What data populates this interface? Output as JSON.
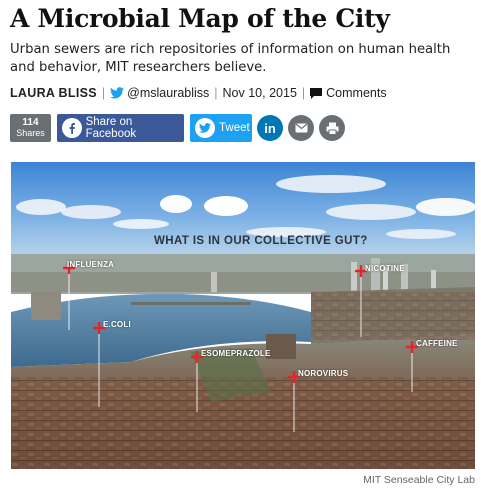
{
  "article": {
    "headline": "A Microbial Map of the City",
    "dek": "Urban sewers are rich repositories of information on human health and behavior, MIT researchers believe.",
    "author": "LAURA BLISS",
    "twitter": "@mslaurabliss",
    "date": "Nov 10, 2015",
    "comments_label": "Comments"
  },
  "share": {
    "count": "114",
    "count_label": "Shares",
    "facebook_label": "Share on Facebook",
    "tweet_label": "Tweet",
    "linkedin_label": "in"
  },
  "figure": {
    "question": "WHAT IS IN OUR COLLECTIVE GUT?",
    "labels": {
      "influenza": "INFLUENZA",
      "ecoli": "E.COLI",
      "esomeprazole": "ESOMEPRAZOLE",
      "norovirus": "NOROVIRUS",
      "caffeine": "CAFFEINE",
      "nicotine": "NICOTINE"
    },
    "credit": "MIT Senseable City Lab"
  },
  "colors": {
    "facebook": "#3b5998",
    "twitter": "#1da1f2",
    "linkedin": "#0077b5",
    "neutral": "#6a6f73",
    "marker": "#e8242a"
  },
  "icons": [
    "twitter-bird-icon",
    "comment-bubble-icon",
    "facebook-icon",
    "twitter-icon",
    "email-icon",
    "print-icon"
  ]
}
